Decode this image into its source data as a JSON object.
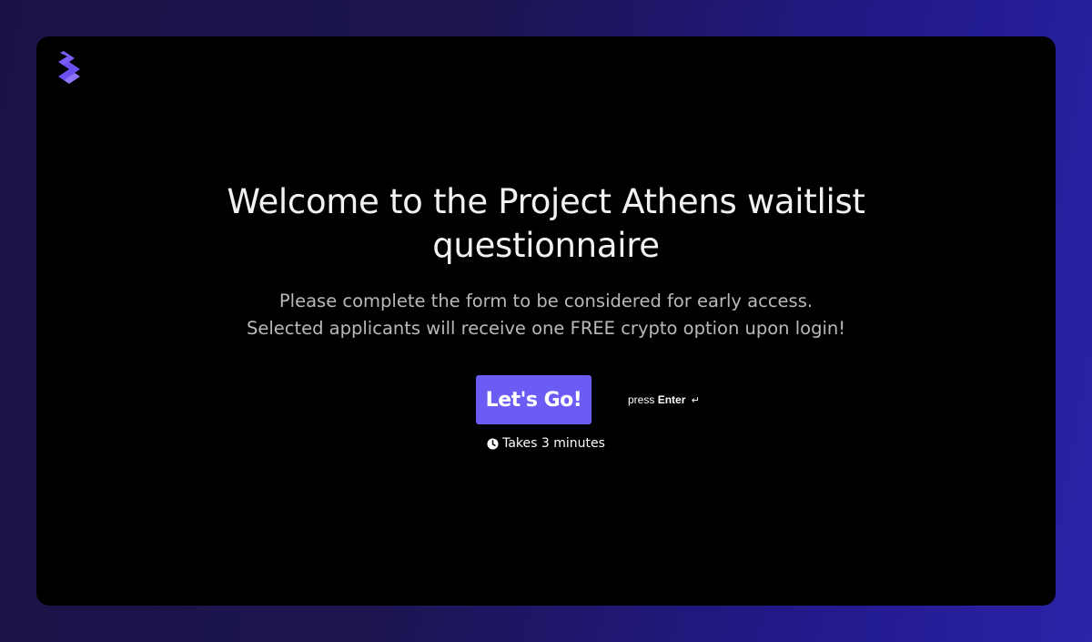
{
  "brand": {
    "logo_icon": "brand-logo-icon",
    "accent_color": "#6b5cf6"
  },
  "welcome": {
    "title": "Welcome to the Project Athens waitlist questionnaire",
    "subtitle_line1": "Please complete the form to be considered for early access.",
    "subtitle_line2": "Selected applicants will receive one FREE crypto option upon login!"
  },
  "cta": {
    "button_label": "Let's Go!",
    "hint_prefix": "press",
    "hint_key": "Enter",
    "hint_icon": "enter-icon",
    "duration_icon": "clock-icon",
    "duration_text": "Takes 3 minutes"
  }
}
